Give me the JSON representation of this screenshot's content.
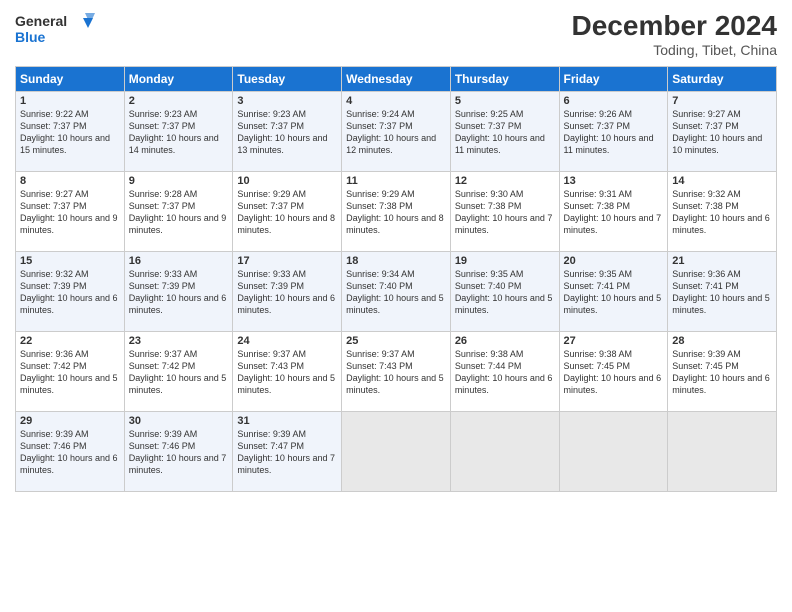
{
  "logo": {
    "line1": "General",
    "line2": "Blue"
  },
  "title": "December 2024",
  "location": "Toding, Tibet, China",
  "days_of_week": [
    "Sunday",
    "Monday",
    "Tuesday",
    "Wednesday",
    "Thursday",
    "Friday",
    "Saturday"
  ],
  "weeks": [
    [
      {
        "day": "1",
        "sunrise": "9:22 AM",
        "sunset": "7:37 PM",
        "daylight": "10 hours and 15 minutes."
      },
      {
        "day": "2",
        "sunrise": "9:23 AM",
        "sunset": "7:37 PM",
        "daylight": "10 hours and 14 minutes."
      },
      {
        "day": "3",
        "sunrise": "9:23 AM",
        "sunset": "7:37 PM",
        "daylight": "10 hours and 13 minutes."
      },
      {
        "day": "4",
        "sunrise": "9:24 AM",
        "sunset": "7:37 PM",
        "daylight": "10 hours and 12 minutes."
      },
      {
        "day": "5",
        "sunrise": "9:25 AM",
        "sunset": "7:37 PM",
        "daylight": "10 hours and 11 minutes."
      },
      {
        "day": "6",
        "sunrise": "9:26 AM",
        "sunset": "7:37 PM",
        "daylight": "10 hours and 11 minutes."
      },
      {
        "day": "7",
        "sunrise": "9:27 AM",
        "sunset": "7:37 PM",
        "daylight": "10 hours and 10 minutes."
      }
    ],
    [
      {
        "day": "8",
        "sunrise": "9:27 AM",
        "sunset": "7:37 PM",
        "daylight": "10 hours and 9 minutes."
      },
      {
        "day": "9",
        "sunrise": "9:28 AM",
        "sunset": "7:37 PM",
        "daylight": "10 hours and 9 minutes."
      },
      {
        "day": "10",
        "sunrise": "9:29 AM",
        "sunset": "7:37 PM",
        "daylight": "10 hours and 8 minutes."
      },
      {
        "day": "11",
        "sunrise": "9:29 AM",
        "sunset": "7:38 PM",
        "daylight": "10 hours and 8 minutes."
      },
      {
        "day": "12",
        "sunrise": "9:30 AM",
        "sunset": "7:38 PM",
        "daylight": "10 hours and 7 minutes."
      },
      {
        "day": "13",
        "sunrise": "9:31 AM",
        "sunset": "7:38 PM",
        "daylight": "10 hours and 7 minutes."
      },
      {
        "day": "14",
        "sunrise": "9:32 AM",
        "sunset": "7:38 PM",
        "daylight": "10 hours and 6 minutes."
      }
    ],
    [
      {
        "day": "15",
        "sunrise": "9:32 AM",
        "sunset": "7:39 PM",
        "daylight": "10 hours and 6 minutes."
      },
      {
        "day": "16",
        "sunrise": "9:33 AM",
        "sunset": "7:39 PM",
        "daylight": "10 hours and 6 minutes."
      },
      {
        "day": "17",
        "sunrise": "9:33 AM",
        "sunset": "7:39 PM",
        "daylight": "10 hours and 6 minutes."
      },
      {
        "day": "18",
        "sunrise": "9:34 AM",
        "sunset": "7:40 PM",
        "daylight": "10 hours and 5 minutes."
      },
      {
        "day": "19",
        "sunrise": "9:35 AM",
        "sunset": "7:40 PM",
        "daylight": "10 hours and 5 minutes."
      },
      {
        "day": "20",
        "sunrise": "9:35 AM",
        "sunset": "7:41 PM",
        "daylight": "10 hours and 5 minutes."
      },
      {
        "day": "21",
        "sunrise": "9:36 AM",
        "sunset": "7:41 PM",
        "daylight": "10 hours and 5 minutes."
      }
    ],
    [
      {
        "day": "22",
        "sunrise": "9:36 AM",
        "sunset": "7:42 PM",
        "daylight": "10 hours and 5 minutes."
      },
      {
        "day": "23",
        "sunrise": "9:37 AM",
        "sunset": "7:42 PM",
        "daylight": "10 hours and 5 minutes."
      },
      {
        "day": "24",
        "sunrise": "9:37 AM",
        "sunset": "7:43 PM",
        "daylight": "10 hours and 5 minutes."
      },
      {
        "day": "25",
        "sunrise": "9:37 AM",
        "sunset": "7:43 PM",
        "daylight": "10 hours and 5 minutes."
      },
      {
        "day": "26",
        "sunrise": "9:38 AM",
        "sunset": "7:44 PM",
        "daylight": "10 hours and 6 minutes."
      },
      {
        "day": "27",
        "sunrise": "9:38 AM",
        "sunset": "7:45 PM",
        "daylight": "10 hours and 6 minutes."
      },
      {
        "day": "28",
        "sunrise": "9:39 AM",
        "sunset": "7:45 PM",
        "daylight": "10 hours and 6 minutes."
      }
    ],
    [
      {
        "day": "29",
        "sunrise": "9:39 AM",
        "sunset": "7:46 PM",
        "daylight": "10 hours and 6 minutes."
      },
      {
        "day": "30",
        "sunrise": "9:39 AM",
        "sunset": "7:46 PM",
        "daylight": "10 hours and 7 minutes."
      },
      {
        "day": "31",
        "sunrise": "9:39 AM",
        "sunset": "7:47 PM",
        "daylight": "10 hours and 7 minutes."
      },
      null,
      null,
      null,
      null
    ]
  ]
}
